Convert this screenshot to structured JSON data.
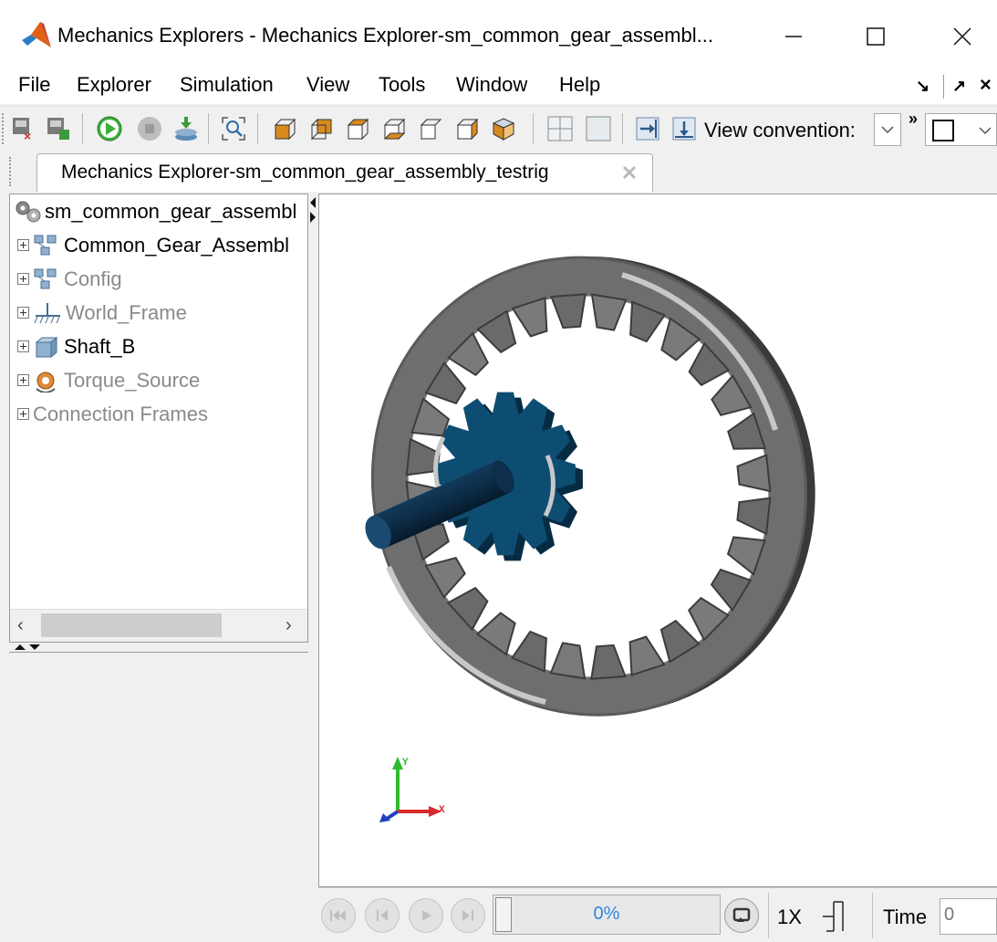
{
  "window": {
    "title": "Mechanics Explorers - Mechanics Explorer-sm_common_gear_assembl...",
    "controls": [
      "minimize-icon",
      "maximize-icon",
      "close-icon"
    ]
  },
  "menu": {
    "items": [
      {
        "label": "File"
      },
      {
        "label": "Explorer"
      },
      {
        "label": "Simulation"
      },
      {
        "label": "View"
      },
      {
        "label": "Tools"
      },
      {
        "label": "Window"
      },
      {
        "label": "Help"
      }
    ]
  },
  "toolbar": {
    "view_convention_label": "View convention:",
    "overflow": "»"
  },
  "tab": {
    "label": "Mechanics Explorer-sm_common_gear_assembly_testrig"
  },
  "tree": {
    "root": "sm_common_gear_assembl",
    "items": [
      {
        "label": "Common_Gear_Assembl",
        "dim": false
      },
      {
        "label": "Config",
        "dim": true
      },
      {
        "label": "World_Frame",
        "dim": true
      },
      {
        "label": "Shaft_B",
        "dim": false
      },
      {
        "label": "Torque_Source",
        "dim": true
      },
      {
        "label": "Connection Frames",
        "dim": true
      }
    ]
  },
  "axes": {
    "y_label": "Y",
    "x_label": "X"
  },
  "playback": {
    "progress_text": "0%",
    "progress_value": 0,
    "speed": "1X",
    "time_label": "Time",
    "time_value": "0"
  },
  "colors": {
    "ring_gear": "#6b6b6b",
    "pinion": "#0e4d72",
    "accent_blue": "#2e86de"
  }
}
